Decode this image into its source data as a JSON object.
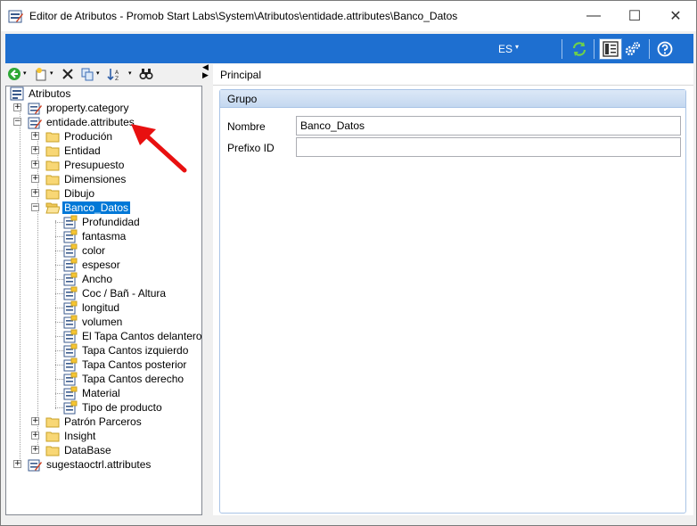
{
  "window": {
    "title": "Editor de Atributos - Promob Start Labs\\System\\Atributos\\entidade.attributes\\Banco_Datos",
    "minimize_glyph": "—",
    "maximize_glyph": "☐",
    "close_glyph": "✕"
  },
  "ribbon": {
    "language": "ES",
    "language_caret": "▾",
    "icons": [
      "refresh-icon",
      "layout-panel-icon",
      "settings-gears-icon",
      "help-icon"
    ]
  },
  "toolbar": {
    "icons": [
      "back-green-icon",
      "new-item-icon",
      "delete-icon",
      "copy-icon",
      "sort-icon",
      "find-icon"
    ],
    "caret": "▾"
  },
  "splitter": {
    "collapse": "◀",
    "expand": "▶"
  },
  "tree": {
    "root": "Atributos",
    "nodes": [
      {
        "label": "property.category"
      },
      {
        "label": "entidade.attributes"
      },
      {
        "label": "Produción"
      },
      {
        "label": "Entidad"
      },
      {
        "label": "Presupuesto"
      },
      {
        "label": "Dimensiones"
      },
      {
        "label": "Dibujo"
      },
      {
        "label": "Banco_Datos"
      },
      {
        "label": "Profundidad"
      },
      {
        "label": "fantasma"
      },
      {
        "label": "color"
      },
      {
        "label": "espesor"
      },
      {
        "label": "Ancho"
      },
      {
        "label": "Coc / Bañ - Altura"
      },
      {
        "label": "longitud"
      },
      {
        "label": "volumen"
      },
      {
        "label": "El Tapa Cantos delantero"
      },
      {
        "label": "Tapa Cantos izquierdo"
      },
      {
        "label": "Tapa Cantos posterior"
      },
      {
        "label": "Tapa Cantos derecho"
      },
      {
        "label": "Material"
      },
      {
        "label": "Tipo de producto"
      },
      {
        "label": "Patrón Parceros"
      },
      {
        "label": "Insight"
      },
      {
        "label": "DataBase"
      },
      {
        "label": "sugestaoctrl.attributes"
      }
    ],
    "expander_plus": "+",
    "expander_minus": "−"
  },
  "details": {
    "tab": "Principal",
    "group_title": "Grupo",
    "fields": [
      {
        "label": "Nombre",
        "value": "Banco_Datos"
      },
      {
        "label": "Prefixo ID",
        "value": ""
      }
    ]
  },
  "colors": {
    "ribbon_blue": "#1e6fd0",
    "selection_blue": "#0078d7",
    "annotation_red": "#e81010"
  }
}
